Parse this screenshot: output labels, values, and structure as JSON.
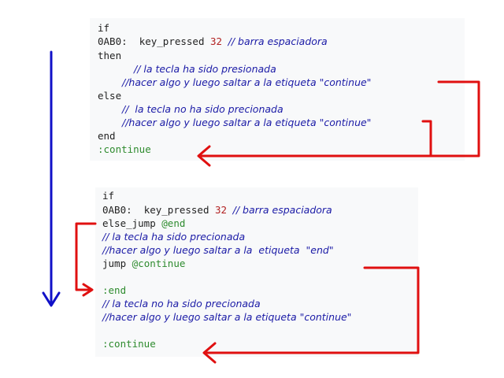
{
  "block1": {
    "if": "if",
    "opcode": "0AB0:",
    "command": "key_pressed",
    "arg": "32",
    "comment_space": "// barra espaciadora",
    "then": "then",
    "comment_pressed": "// la tecla ha sido presionada",
    "comment_jump1": "//hacer algo y luego saltar a la etiqueta \"continue\"",
    "else": "else",
    "comment_not_pressed": "//  la tecla no ha sido precionada",
    "comment_jump2": "//hacer algo y luego saltar a la etiqueta \"continue\"",
    "end": "end",
    "label_continue": ":continue"
  },
  "block2": {
    "if": "if",
    "opcode": "0AB0:",
    "command": "key_pressed",
    "arg": "32",
    "comment_space": "// barra espaciadora",
    "else_jump": "else_jump",
    "else_jump_target": "@end",
    "comment_pressed": "// la tecla ha sido precionada",
    "comment_jump_end": "//hacer algo y luego saltar a la  etiqueta  \"end\"",
    "jump": "jump",
    "jump_target": "@continue",
    "label_end": ":end",
    "comment_not_pressed": "// la tecla no ha sido precionada",
    "comment_jump_continue": "//hacer algo y luego saltar a la etiqueta \"continue\"",
    "label_continue": ":continue"
  },
  "colors": {
    "flow_arrow": "#1010c8",
    "jump_arrow": "#e01010",
    "keyword": "#222222",
    "comment": "#1a1aa6",
    "number": "#b22222",
    "label": "#2e8b2e"
  }
}
